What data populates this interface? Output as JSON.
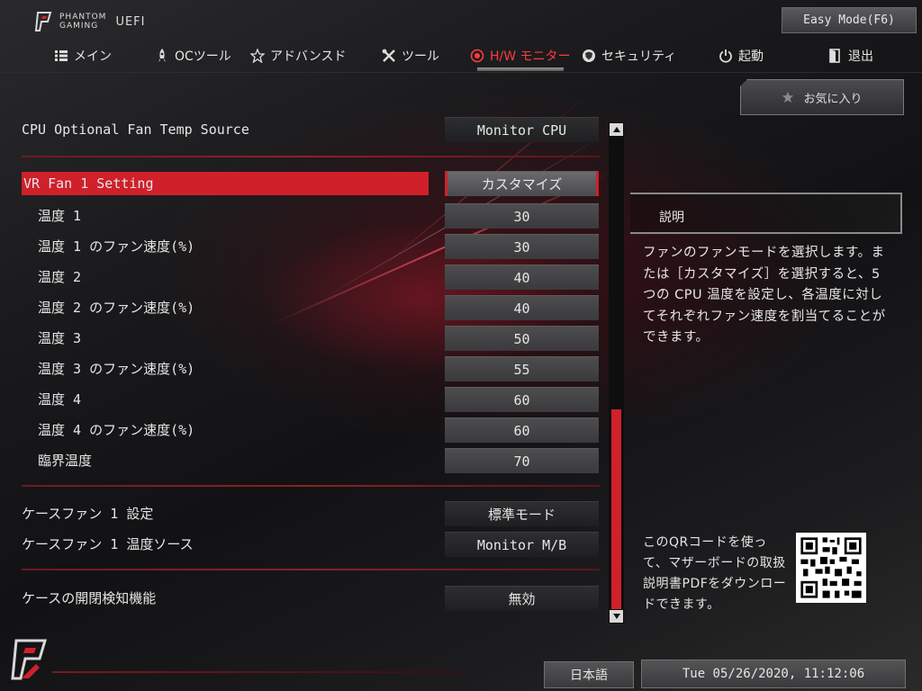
{
  "header": {
    "brand_line1": "PHANTOM",
    "brand_line2": "GAMING",
    "uefi_label": "UEFI",
    "easy_mode_button": "Easy Mode(F6)"
  },
  "nav": {
    "items": [
      {
        "label": "メイン",
        "icon": "list-icon"
      },
      {
        "label": "OCツール",
        "icon": "rocket-icon"
      },
      {
        "label": "アドバンスド",
        "icon": "star-icon"
      },
      {
        "label": "ツール",
        "icon": "tools-icon"
      },
      {
        "label": "H/W モニター",
        "icon": "monitor-icon",
        "active": true
      },
      {
        "label": "セキュリティ",
        "icon": "shield-icon"
      },
      {
        "label": "起動",
        "icon": "power-icon"
      },
      {
        "label": "退出",
        "icon": "exit-icon"
      }
    ]
  },
  "settings": {
    "cpu_fan_source": {
      "label": "CPU Optional Fan Temp Source",
      "value": "Monitor CPU"
    },
    "vr_fan": {
      "label": "VR Fan 1 Setting",
      "value": "カスタマイズ"
    },
    "sub_items": [
      {
        "label": "温度 1",
        "value": "30"
      },
      {
        "label": "温度 1 のファン速度(%)",
        "value": "30"
      },
      {
        "label": "温度 2",
        "value": "40"
      },
      {
        "label": "温度 2 のファン速度(%)",
        "value": "40"
      },
      {
        "label": "温度 3",
        "value": "50"
      },
      {
        "label": "温度 3 のファン速度(%)",
        "value": "55"
      },
      {
        "label": "温度 4",
        "value": "60"
      },
      {
        "label": "温度 4 のファン速度(%)",
        "value": "60"
      },
      {
        "label": "臨界温度",
        "value": "70"
      }
    ],
    "case_fan_setting": {
      "label": "ケースファン 1 設定",
      "value": "標準モード"
    },
    "case_fan_source": {
      "label": "ケースファン 1 温度ソース",
      "value": "Monitor M/B"
    },
    "case_open": {
      "label": "ケースの開閉検知機能",
      "value": "無効"
    }
  },
  "side": {
    "favorites_label": "お気に入り",
    "description_title": "説明",
    "description_text": "ファンのファンモードを選択します。または［カスタマイズ］を選択すると、5 つの CPU 温度を設定し、各温度に対してそれぞれファン速度を割当てることができます。",
    "qr_text": "このQRコードを使って、マザーボードの取扱説明書PDFをダウンロードできます。"
  },
  "footer": {
    "language": "日本語",
    "datetime": "Tue 05/26/2020, 11:12:06"
  },
  "colors": {
    "accent": "#d0202a",
    "active_nav": "#ff3b3b",
    "background": "#151517"
  }
}
